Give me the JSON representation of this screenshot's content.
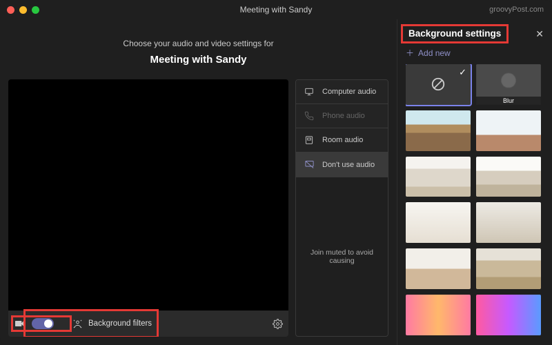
{
  "window": {
    "title": "Meeting with Sandy",
    "watermark": "groovyPost.com"
  },
  "main": {
    "prompt": "Choose your audio and video settings for",
    "meeting_name": "Meeting with Sandy",
    "bg_filters_label": "Background filters"
  },
  "audio": {
    "computer": "Computer audio",
    "phone": "Phone audio",
    "room": "Room audio",
    "none": "Don't use audio",
    "note": "Join muted to avoid causing"
  },
  "sidebar": {
    "title": "Background settings",
    "add_new": "Add new",
    "blur_label": "Blur"
  }
}
